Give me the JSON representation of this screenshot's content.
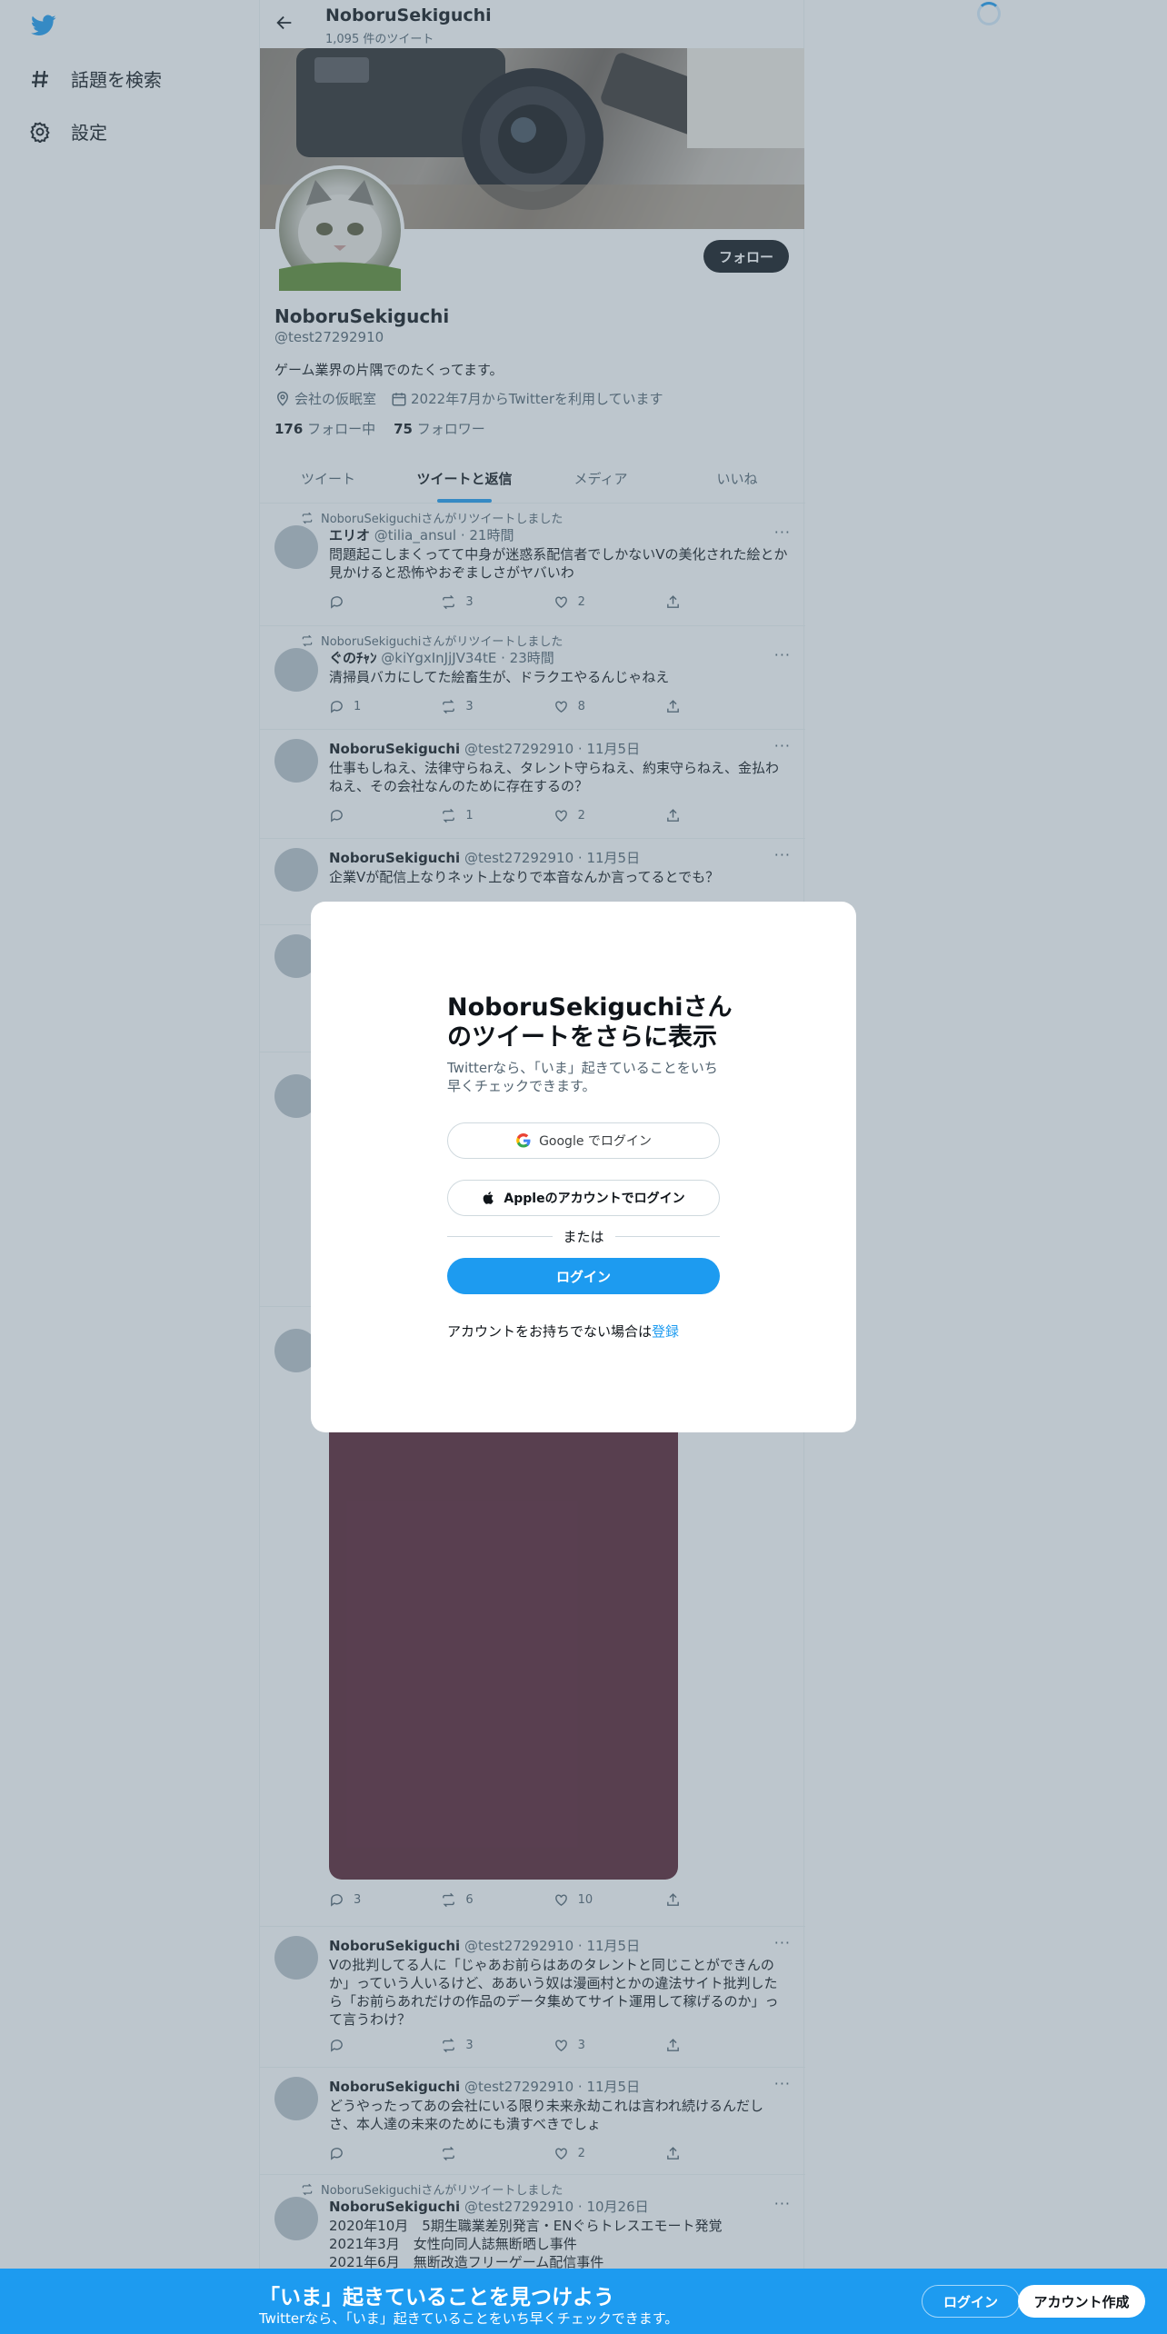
{
  "nav": {
    "explore_label": "話題を検索",
    "settings_label": "設定"
  },
  "header": {
    "title": "NoboruSekiguchi",
    "tweet_count": "1,095 件のツイート"
  },
  "profile": {
    "follow_label": "フォロー",
    "name": "NoboruSekiguchi",
    "handle": "@test27292910",
    "bio": "ゲーム業界の片隅でのたくってます。",
    "location": "会社の仮眠室",
    "joined": "2022年7月からTwitterを利用しています",
    "following_count": "176",
    "following_label": "フォロー中",
    "followers_count": "75",
    "followers_label": "フォロワー"
  },
  "tabs": [
    "ツイート",
    "ツイートと返信",
    "メディア",
    "いいね"
  ],
  "tweets": [
    {
      "context": "NoboruSekiguchiさんがリツイートしました",
      "name": "エリオ",
      "meta": "@tilia_ansul · 21時間",
      "text": "問題起こしまくってて中身が迷惑系配信者でしかないVの美化された絵とか\n見かけると恐怖やおぞましさがヤバいわ",
      "reply": "",
      "retweet": "3",
      "like": "2"
    },
    {
      "context": "NoboruSekiguchiさんがリツイートしました",
      "name": "ぐのﾁｬﾝ",
      "meta": "@kiYgxInJjJV34tE · 23時間",
      "text": "清掃員バカにしてた絵畜生が、ドラクエやるんじゃねえ",
      "reply": "1",
      "retweet": "3",
      "like": "8"
    },
    {
      "context": "",
      "name": "NoboruSekiguchi",
      "meta": "@test27292910 · 11月5日",
      "text": "仕事もしねえ、法律守らねえ、タレント守らねえ、約束守らねえ、金払わ\nねえ、その会社なんのために存在するの？",
      "reply": "",
      "retweet": "1",
      "like": "2"
    },
    {
      "context": "",
      "name": "NoboruSekiguchi",
      "meta": "@test27292910 · 11月5日",
      "text": "企業Vが配信上なりネット上なりで本音なんか言ってるとでも？",
      "reply": "",
      "retweet": "",
      "like": ""
    },
    {
      "context": "",
      "name": "",
      "meta": "",
      "text": "",
      "reply": "3",
      "retweet": "6",
      "like": "10"
    },
    {
      "context": "",
      "name": "NoboruSekiguchi",
      "meta": "@test27292910 · 11月5日",
      "text": "Vの批判してる人に「じゃあお前らはあのタレントと同じことができんの\nか」っていう人いるけど、ああいう奴は漫画村とかの違法サイト批判した\nら「お前らあれだけの作品のデータ集めてサイト運用して稼げるのか」っ\nて言うわけ？",
      "reply": "",
      "retweet": "3",
      "like": "3"
    },
    {
      "context": "",
      "name": "NoboruSekiguchi",
      "meta": "@test27292910 · 11月5日",
      "text": "どうやったってあの会社にいる限り未来永劫これは言われ続けるんだし\nさ、本人達の未来のためにも潰すべきでしょ",
      "reply": "",
      "retweet": "",
      "like": "2"
    },
    {
      "context": "NoboruSekiguchiさんがリツイートしました",
      "name": "NoboruSekiguchi",
      "meta": "@test27292910 · 10月26日",
      "text": "2020年10月　5期生職業差別発言・ENぐらトレスエモート発覚\n2021年3月　女性向同人誌無断晒し事件\n2021年6月　無断改造フリーゲーム配信事件",
      "reply": "",
      "retweet": "",
      "like": ""
    }
  ],
  "modal": {
    "title": "NoboruSekiguchiさんのツイートをさらに表示",
    "subtitle": "Twitterなら、「いま」起きていることをいち早くチェックできます。",
    "google_label": "Google でログイン",
    "apple_label": "Appleのアカウントでログイン",
    "or_label": "または",
    "login_label": "ログイン",
    "signup_prompt": "アカウントをお持ちでない場合は",
    "signup_link": "登録"
  },
  "bottom_bar": {
    "title": "「いま」起きていることを見つけよう",
    "subtitle": "Twitterなら、「いま」起きていることをいち早くチェックできます。",
    "login_label": "ログイン",
    "signup_label": "アカウント作成"
  },
  "colors": {
    "accent": "#1d9bf0",
    "text": "#0f1419",
    "muted": "#536471"
  }
}
